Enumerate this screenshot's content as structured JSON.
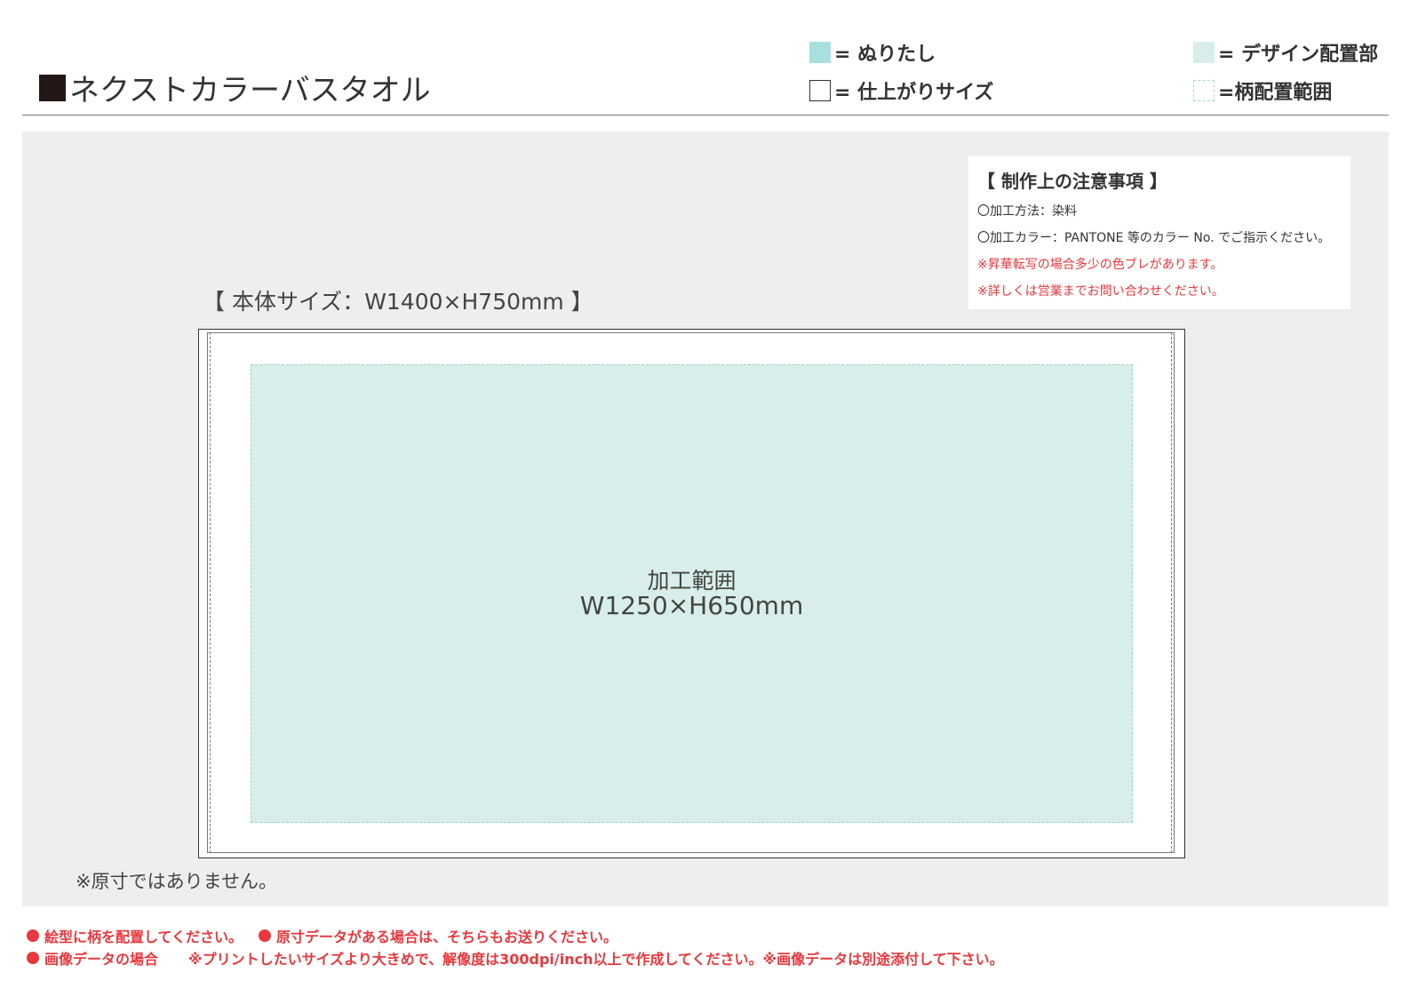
{
  "header": {
    "title": "ネクストカラーバスタオル",
    "legend": {
      "bleed": "= ぬりたし",
      "finish_size": "= 仕上がりサイズ",
      "design_area": "= デザイン配置部",
      "pattern_range": "=柄配置範囲"
    }
  },
  "notes": {
    "title": "【 制作上の注意事項 】",
    "lines": [
      "〇加工方法：染料",
      "〇加工カラー：PANTONE 等のカラー No. でご指示ください。",
      "※昇華転写の場合多少の色ブレがあります。",
      "※詳しくは営業までお問い合わせください。"
    ]
  },
  "template": {
    "body_size": "【 本体サイズ：W1400×H750mm 】",
    "area_label": "加工範囲",
    "area_size": "W1250×H650mm",
    "scale_note": "※原寸ではありません。"
  },
  "footer": {
    "line1_a": "絵型に柄を配置してください。",
    "line1_b": "原寸データがある場合は、そちらもお送りください。",
    "line2_a": "画像データの場合",
    "line2_b": "※プリントしたいサイズより大きめで、解像度は300dpi/inch以上で作成してください。※画像データは別途添付して下さい。"
  },
  "colors": {
    "bleed": "#a9dfdf",
    "design_area": "#d8eeea",
    "panel": "#eeeeec",
    "warning_red": "#e8383d",
    "title_square": "#231815"
  }
}
